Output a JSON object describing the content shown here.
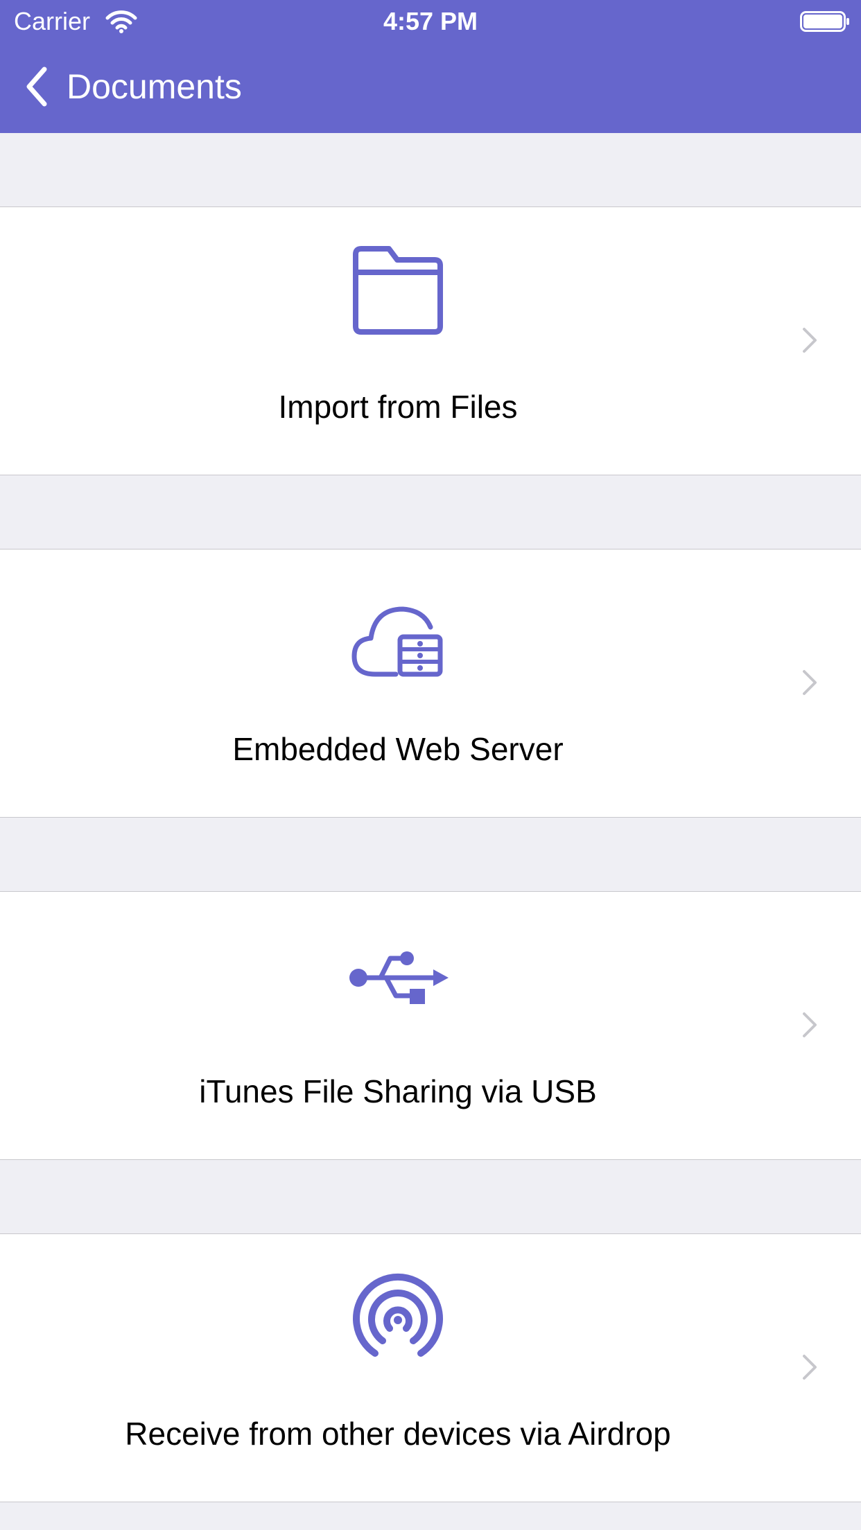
{
  "status_bar": {
    "carrier": "Carrier",
    "time": "4:57 PM",
    "icons": [
      "wifi-icon",
      "battery-icon"
    ]
  },
  "nav_bar": {
    "back_label": "Documents",
    "back_icon": "chevron-left-icon"
  },
  "colors": {
    "accent": "#6666cc",
    "background": "#efeff4",
    "cell_background": "#ffffff",
    "separator": "#c8c7cc",
    "disclosure": "#c7c7cc"
  },
  "options": [
    {
      "label": "Import from Files",
      "icon": "folder-icon"
    },
    {
      "label": "Embedded Web Server",
      "icon": "cloud-server-icon"
    },
    {
      "label": "iTunes File Sharing via USB",
      "icon": "usb-icon"
    },
    {
      "label": "Receive from other devices via Airdrop",
      "icon": "airdrop-icon"
    }
  ]
}
